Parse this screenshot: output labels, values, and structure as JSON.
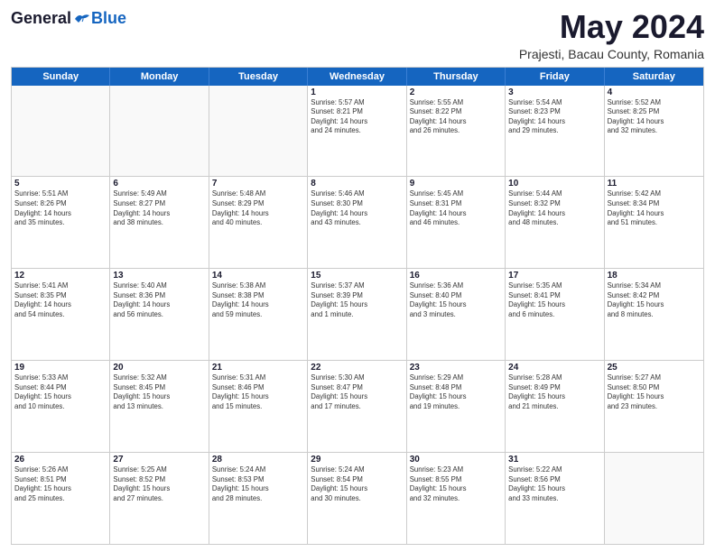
{
  "header": {
    "logo_general": "General",
    "logo_blue": "Blue",
    "title": "May 2024",
    "location": "Prajesti, Bacau County, Romania"
  },
  "days": [
    "Sunday",
    "Monday",
    "Tuesday",
    "Wednesday",
    "Thursday",
    "Friday",
    "Saturday"
  ],
  "weeks": [
    [
      {
        "day": "",
        "text": ""
      },
      {
        "day": "",
        "text": ""
      },
      {
        "day": "",
        "text": ""
      },
      {
        "day": "1",
        "text": "Sunrise: 5:57 AM\nSunset: 8:21 PM\nDaylight: 14 hours\nand 24 minutes."
      },
      {
        "day": "2",
        "text": "Sunrise: 5:55 AM\nSunset: 8:22 PM\nDaylight: 14 hours\nand 26 minutes."
      },
      {
        "day": "3",
        "text": "Sunrise: 5:54 AM\nSunset: 8:23 PM\nDaylight: 14 hours\nand 29 minutes."
      },
      {
        "day": "4",
        "text": "Sunrise: 5:52 AM\nSunset: 8:25 PM\nDaylight: 14 hours\nand 32 minutes."
      }
    ],
    [
      {
        "day": "5",
        "text": "Sunrise: 5:51 AM\nSunset: 8:26 PM\nDaylight: 14 hours\nand 35 minutes."
      },
      {
        "day": "6",
        "text": "Sunrise: 5:49 AM\nSunset: 8:27 PM\nDaylight: 14 hours\nand 38 minutes."
      },
      {
        "day": "7",
        "text": "Sunrise: 5:48 AM\nSunset: 8:29 PM\nDaylight: 14 hours\nand 40 minutes."
      },
      {
        "day": "8",
        "text": "Sunrise: 5:46 AM\nSunset: 8:30 PM\nDaylight: 14 hours\nand 43 minutes."
      },
      {
        "day": "9",
        "text": "Sunrise: 5:45 AM\nSunset: 8:31 PM\nDaylight: 14 hours\nand 46 minutes."
      },
      {
        "day": "10",
        "text": "Sunrise: 5:44 AM\nSunset: 8:32 PM\nDaylight: 14 hours\nand 48 minutes."
      },
      {
        "day": "11",
        "text": "Sunrise: 5:42 AM\nSunset: 8:34 PM\nDaylight: 14 hours\nand 51 minutes."
      }
    ],
    [
      {
        "day": "12",
        "text": "Sunrise: 5:41 AM\nSunset: 8:35 PM\nDaylight: 14 hours\nand 54 minutes."
      },
      {
        "day": "13",
        "text": "Sunrise: 5:40 AM\nSunset: 8:36 PM\nDaylight: 14 hours\nand 56 minutes."
      },
      {
        "day": "14",
        "text": "Sunrise: 5:38 AM\nSunset: 8:38 PM\nDaylight: 14 hours\nand 59 minutes."
      },
      {
        "day": "15",
        "text": "Sunrise: 5:37 AM\nSunset: 8:39 PM\nDaylight: 15 hours\nand 1 minute."
      },
      {
        "day": "16",
        "text": "Sunrise: 5:36 AM\nSunset: 8:40 PM\nDaylight: 15 hours\nand 3 minutes."
      },
      {
        "day": "17",
        "text": "Sunrise: 5:35 AM\nSunset: 8:41 PM\nDaylight: 15 hours\nand 6 minutes."
      },
      {
        "day": "18",
        "text": "Sunrise: 5:34 AM\nSunset: 8:42 PM\nDaylight: 15 hours\nand 8 minutes."
      }
    ],
    [
      {
        "day": "19",
        "text": "Sunrise: 5:33 AM\nSunset: 8:44 PM\nDaylight: 15 hours\nand 10 minutes."
      },
      {
        "day": "20",
        "text": "Sunrise: 5:32 AM\nSunset: 8:45 PM\nDaylight: 15 hours\nand 13 minutes."
      },
      {
        "day": "21",
        "text": "Sunrise: 5:31 AM\nSunset: 8:46 PM\nDaylight: 15 hours\nand 15 minutes."
      },
      {
        "day": "22",
        "text": "Sunrise: 5:30 AM\nSunset: 8:47 PM\nDaylight: 15 hours\nand 17 minutes."
      },
      {
        "day": "23",
        "text": "Sunrise: 5:29 AM\nSunset: 8:48 PM\nDaylight: 15 hours\nand 19 minutes."
      },
      {
        "day": "24",
        "text": "Sunrise: 5:28 AM\nSunset: 8:49 PM\nDaylight: 15 hours\nand 21 minutes."
      },
      {
        "day": "25",
        "text": "Sunrise: 5:27 AM\nSunset: 8:50 PM\nDaylight: 15 hours\nand 23 minutes."
      }
    ],
    [
      {
        "day": "26",
        "text": "Sunrise: 5:26 AM\nSunset: 8:51 PM\nDaylight: 15 hours\nand 25 minutes."
      },
      {
        "day": "27",
        "text": "Sunrise: 5:25 AM\nSunset: 8:52 PM\nDaylight: 15 hours\nand 27 minutes."
      },
      {
        "day": "28",
        "text": "Sunrise: 5:24 AM\nSunset: 8:53 PM\nDaylight: 15 hours\nand 28 minutes."
      },
      {
        "day": "29",
        "text": "Sunrise: 5:24 AM\nSunset: 8:54 PM\nDaylight: 15 hours\nand 30 minutes."
      },
      {
        "day": "30",
        "text": "Sunrise: 5:23 AM\nSunset: 8:55 PM\nDaylight: 15 hours\nand 32 minutes."
      },
      {
        "day": "31",
        "text": "Sunrise: 5:22 AM\nSunset: 8:56 PM\nDaylight: 15 hours\nand 33 minutes."
      },
      {
        "day": "",
        "text": ""
      }
    ]
  ]
}
